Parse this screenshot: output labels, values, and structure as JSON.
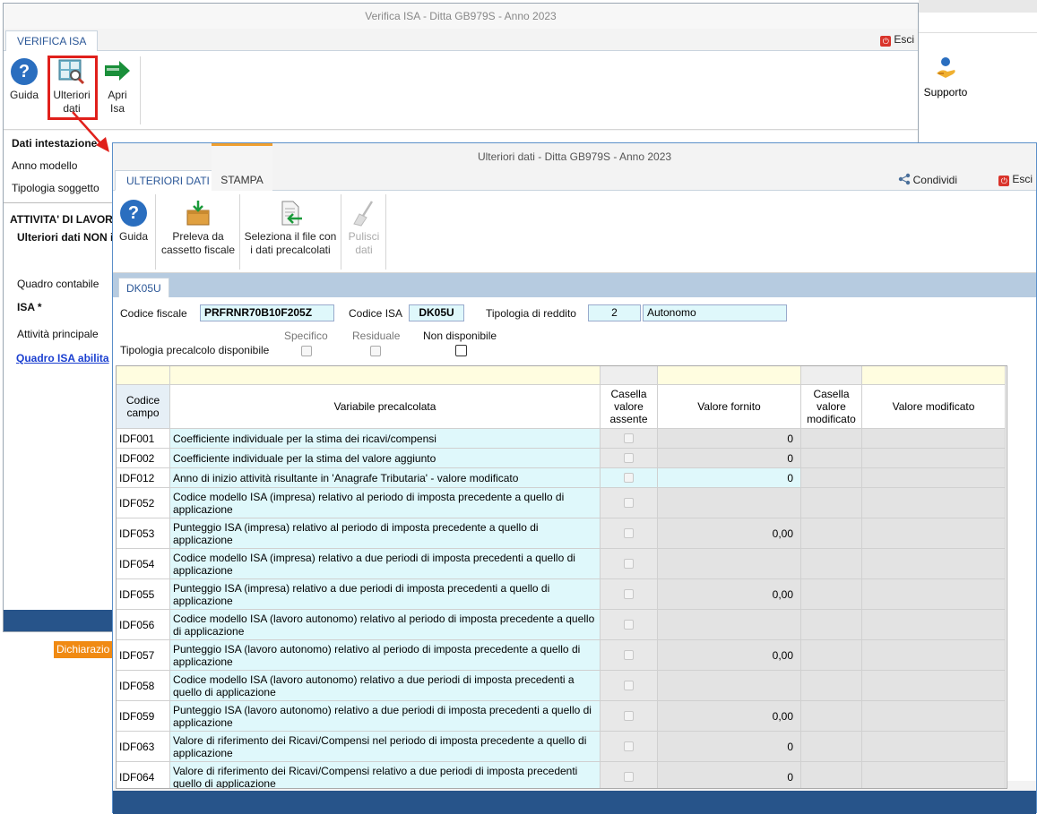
{
  "background": {
    "supporto_label": "Supporto",
    "dichiarazione_badge": "Dichiarazio"
  },
  "main_window": {
    "title": "Verifica ISA - Ditta GB979S - Anno 2023",
    "tab": "VERIFICA ISA",
    "exit_label": "Esci",
    "ribbon": {
      "guida": "Guida",
      "ulteriori_line1": "Ulteriori",
      "ulteriori_line2": "dati",
      "apri_line1": "Apri",
      "apri_line2": "Isa"
    },
    "body": {
      "dati_intestazione": "Dati intestazione",
      "anno_modello": "Anno modello",
      "tipologia_soggetto": "Tipologia soggetto",
      "attivita": "ATTIVITA' DI LAVORO",
      "ulteriori_non": "Ulteriori dati NON i",
      "quadro_contabile": "Quadro contabile",
      "isa": "ISA  *",
      "attivita_principale": "Attività principale",
      "quadro_isa_link": "Quadro ISA abilita"
    }
  },
  "dialog": {
    "title": "Ulteriori dati - Ditta GB979S - Anno 2023",
    "tabs": [
      "ULTERIORI DATI",
      "STAMPA"
    ],
    "condividi_label": "Condividi",
    "exit_label": "Esci",
    "ribbon": {
      "guida": "Guida",
      "preleva_line1": "Preleva da",
      "preleva_line2": "cassetto fiscale",
      "seleziona_line1": "Seleziona il file con",
      "seleziona_line2": "i dati precalcolati",
      "pulisci_line1": "Pulisci",
      "pulisci_line2": "dati"
    },
    "sub_tab": "DK05U",
    "form": {
      "codice_fiscale_label": "Codice fiscale",
      "codice_fiscale_value": "PRFRNR70B10F205Z",
      "codice_isa_label": "Codice ISA",
      "codice_isa_value": "DK05U",
      "tipologia_reddito_label": "Tipologia di reddito",
      "tipologia_reddito_code": "2",
      "tipologia_reddito_desc": "Autonomo",
      "tipologia_precalcolo_label": "Tipologia precalcolo disponibile",
      "options": [
        "Specifico",
        "Residuale",
        "Non disponibile"
      ]
    },
    "grid": {
      "headers": {
        "codice_line1": "Codice",
        "codice_line2": "campo",
        "variabile": "Variabile precalcolata",
        "casella_assente_line1": "Casella",
        "casella_assente_line2": "valore",
        "casella_assente_line3": "assente",
        "valore_fornito": "Valore fornito",
        "casella_mod_line1": "Casella",
        "casella_mod_line2": "valore",
        "casella_mod_line3": "modificato",
        "valore_modificato": "Valore modificato"
      },
      "rows": [
        {
          "code": "IDF001",
          "desc": "Coefficiente individuale per la stima dei ricavi/compensi",
          "value": "0"
        },
        {
          "code": "IDF002",
          "desc": "Coefficiente individuale per la stima del valore aggiunto",
          "value": "0"
        },
        {
          "code": "IDF012",
          "desc": "Anno di inizio attività risultante in 'Anagrafe Tributaria' - valore modificato",
          "value": "0"
        },
        {
          "code": "IDF052",
          "desc": "Codice modello ISA (impresa) relativo al periodo di imposta precedente a quello di applicazione",
          "value": ""
        },
        {
          "code": "IDF053",
          "desc": "Punteggio ISA (impresa) relativo al periodo di imposta precedente a quello di applicazione",
          "value": "0,00"
        },
        {
          "code": "IDF054",
          "desc": "Codice modello ISA (impresa) relativo a due periodi di imposta precedenti a quello di applicazione",
          "value": ""
        },
        {
          "code": "IDF055",
          "desc": "Punteggio ISA (impresa) relativo a due periodi di imposta precedenti a quello di applicazione",
          "value": "0,00"
        },
        {
          "code": "IDF056",
          "desc": "Codice modello ISA (lavoro autonomo) relativo al periodo di imposta precedente a quello di applicazione",
          "value": ""
        },
        {
          "code": "IDF057",
          "desc": "Punteggio ISA (lavoro autonomo) relativo al periodo di imposta precedente a quello di applicazione",
          "value": "0,00"
        },
        {
          "code": "IDF058",
          "desc": "Codice modello ISA (lavoro autonomo) relativo a due periodi di imposta precedenti a quello di applicazione",
          "value": ""
        },
        {
          "code": "IDF059",
          "desc": "Punteggio ISA (lavoro autonomo) relativo a due periodi di imposta precedenti a quello di applicazione",
          "value": "0,00"
        },
        {
          "code": "IDF063",
          "desc": "Valore di riferimento dei Ricavi/Compensi nel periodo di imposta precedente a quello di applicazione",
          "value": "0"
        },
        {
          "code": "IDF064",
          "desc": "Valore di riferimento dei Ricavi/Compensi relativo a due periodi di imposta precedenti quello di applicazione",
          "value": "0"
        }
      ]
    }
  },
  "colors": {
    "accent_blue": "#27548a",
    "cyan_cell": "#dff8fb",
    "highlight_red": "#e0201b",
    "stampa_orange": "#f0a030"
  }
}
